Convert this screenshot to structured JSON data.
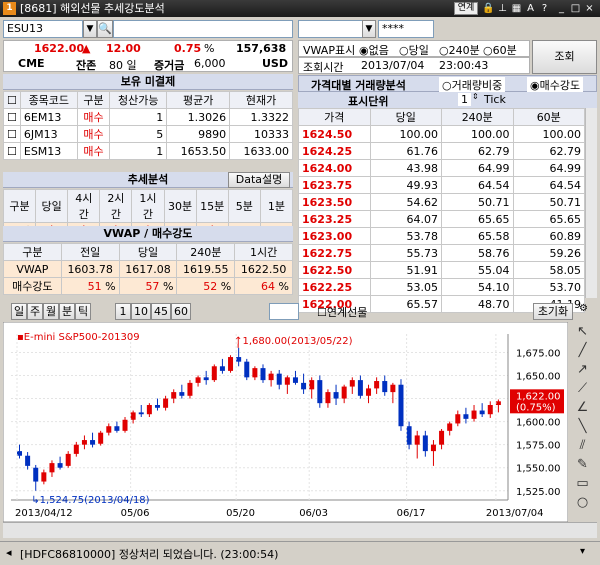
{
  "window": {
    "number": "1",
    "title": "[8681] 해외선물 추세강도분석",
    "buttons": [
      "연계",
      "A",
      "?"
    ],
    "controls": [
      "_",
      "□",
      "×"
    ]
  },
  "search": {
    "symbol": "ESU13",
    "right_value": "****"
  },
  "quote": {
    "price": "1622.00",
    "change_arrow": "▲",
    "change": "12.00",
    "pct": "0.75",
    "pct_unit": "%",
    "volume": "157,638",
    "exchange": "CME",
    "remain_label": "잔존",
    "remain_days": "80 일",
    "deposit_label": "증거금",
    "deposit": "6,000",
    "currency": "USD"
  },
  "vwap_opts": {
    "label": "VWAP표시",
    "options": [
      "없음",
      "당일",
      "240분",
      "60분"
    ],
    "selected": 0
  },
  "query_btn": "조회",
  "query_time": {
    "label": "조회시간",
    "date": "2013/07/04",
    "time": "23:00:43"
  },
  "holdings": {
    "title": "보유 미결제",
    "headers": [
      "종목코드",
      "구분",
      "청산가능",
      "평균가",
      "현재가"
    ],
    "rows": [
      [
        "6EM13",
        "매수",
        "1",
        "1.3026",
        "1.3322"
      ],
      [
        "6JM13",
        "매수",
        "5",
        "9890",
        "10333"
      ],
      [
        "ESM13",
        "매수",
        "1",
        "1653.50",
        "1633.00"
      ]
    ]
  },
  "trend": {
    "title": "추세분석",
    "data_btn": "Data설명",
    "headers": [
      "구분",
      "당일",
      "4시간",
      "2시간",
      "1시간",
      "30분",
      "15분",
      "5분",
      "1분"
    ],
    "row_label": "추세",
    "arrows": [
      "up",
      "up",
      "up",
      "up",
      "dash",
      "up",
      "dash",
      "dash"
    ]
  },
  "vwap": {
    "title": "VWAP / 매수강도",
    "headers": [
      "구분",
      "전일",
      "당일",
      "240분",
      "1시간"
    ],
    "rows": [
      {
        "label": "VWAP",
        "values": [
          "1603.78",
          "1617.08",
          "1619.55",
          "1622.50"
        ]
      },
      {
        "label": "매수강도",
        "values": [
          "51",
          "57",
          "52",
          "64"
        ],
        "unit": "%"
      }
    ]
  },
  "price_vol": {
    "title": "가격대별 거래량분석",
    "opt1": "거래량비중",
    "opt2": "매수강도",
    "selected": 1,
    "unit_label": "표시단위",
    "unit_value": "1",
    "unit_suffix": "Tick",
    "headers": [
      "가격",
      "당일",
      "240분",
      "60분"
    ],
    "rows": [
      [
        "1624.50",
        "100.00",
        "100.00",
        "100.00"
      ],
      [
        "1624.25",
        "61.76",
        "62.79",
        "62.79"
      ],
      [
        "1624.00",
        "43.98",
        "64.99",
        "64.99"
      ],
      [
        "1623.75",
        "49.93",
        "64.54",
        "64.54"
      ],
      [
        "1623.50",
        "54.62",
        "50.71",
        "50.71"
      ],
      [
        "1623.25",
        "64.07",
        "65.65",
        "65.65"
      ],
      [
        "1623.00",
        "53.78",
        "65.58",
        "60.89"
      ],
      [
        "1622.75",
        "55.73",
        "58.76",
        "59.26"
      ],
      [
        "1622.50",
        "51.91",
        "55.04",
        "58.05"
      ],
      [
        "1622.25",
        "53.05",
        "54.10",
        "53.70"
      ],
      [
        "1622.00",
        "65.57",
        "48.70",
        "41.19"
      ]
    ]
  },
  "chart_toolbar": {
    "periods": [
      "일",
      "주",
      "월",
      "분",
      "틱"
    ],
    "intervals": [
      "1",
      "10",
      "45",
      "60"
    ],
    "combo": "",
    "linked": "연계선물",
    "reset": "초기화"
  },
  "chart_data": {
    "type": "candlestick",
    "title": "E-mini S&P500-201309",
    "y_ticks": [
      "1,675.00",
      "1,650.00",
      "1,625.00",
      "1,600.00",
      "1,575.00",
      "1,550.00",
      "1,525.00"
    ],
    "x_ticks": [
      "2013/04/12",
      "05/06",
      "05/20",
      "06/03",
      "06/17",
      "2013/07/04"
    ],
    "high_annotation": "1,680.00(2013/05/22)",
    "low_annotation": "1,524.75(2013/04/18)",
    "last_price": "1,622.00",
    "last_pct": "0.75%",
    "ylim": [
      1515,
      1695
    ],
    "ohlc": [
      [
        1568,
        1575,
        1560,
        1563
      ],
      [
        1563,
        1567,
        1548,
        1552
      ],
      [
        1550,
        1553,
        1525,
        1535
      ],
      [
        1535,
        1548,
        1532,
        1545
      ],
      [
        1545,
        1558,
        1540,
        1555
      ],
      [
        1555,
        1562,
        1548,
        1550
      ],
      [
        1552,
        1568,
        1550,
        1565
      ],
      [
        1565,
        1578,
        1562,
        1575
      ],
      [
        1575,
        1585,
        1570,
        1580
      ],
      [
        1580,
        1588,
        1572,
        1575
      ],
      [
        1576,
        1590,
        1574,
        1588
      ],
      [
        1588,
        1598,
        1585,
        1595
      ],
      [
        1595,
        1600,
        1588,
        1590
      ],
      [
        1590,
        1605,
        1588,
        1602
      ],
      [
        1602,
        1612,
        1598,
        1610
      ],
      [
        1610,
        1618,
        1605,
        1608
      ],
      [
        1608,
        1620,
        1605,
        1618
      ],
      [
        1618,
        1625,
        1612,
        1615
      ],
      [
        1615,
        1628,
        1612,
        1625
      ],
      [
        1625,
        1635,
        1620,
        1632
      ],
      [
        1632,
        1640,
        1625,
        1628
      ],
      [
        1628,
        1645,
        1625,
        1642
      ],
      [
        1642,
        1650,
        1638,
        1648
      ],
      [
        1648,
        1655,
        1640,
        1645
      ],
      [
        1645,
        1662,
        1643,
        1660
      ],
      [
        1660,
        1668,
        1652,
        1655
      ],
      [
        1655,
        1672,
        1653,
        1670
      ],
      [
        1670,
        1680,
        1660,
        1665
      ],
      [
        1665,
        1668,
        1645,
        1648
      ],
      [
        1648,
        1660,
        1645,
        1658
      ],
      [
        1658,
        1662,
        1642,
        1645
      ],
      [
        1645,
        1655,
        1638,
        1652
      ],
      [
        1652,
        1656,
        1635,
        1640
      ],
      [
        1640,
        1650,
        1630,
        1648
      ],
      [
        1648,
        1655,
        1640,
        1642
      ],
      [
        1642,
        1652,
        1630,
        1635
      ],
      [
        1635,
        1648,
        1625,
        1645
      ],
      [
        1645,
        1650,
        1615,
        1620
      ],
      [
        1620,
        1635,
        1615,
        1632
      ],
      [
        1632,
        1640,
        1618,
        1625
      ],
      [
        1625,
        1640,
        1620,
        1638
      ],
      [
        1638,
        1648,
        1630,
        1645
      ],
      [
        1645,
        1650,
        1625,
        1628
      ],
      [
        1628,
        1640,
        1620,
        1636
      ],
      [
        1636,
        1648,
        1630,
        1644
      ],
      [
        1644,
        1650,
        1628,
        1632
      ],
      [
        1632,
        1642,
        1620,
        1640
      ],
      [
        1640,
        1646,
        1590,
        1595
      ],
      [
        1595,
        1600,
        1570,
        1575
      ],
      [
        1575,
        1590,
        1560,
        1585
      ],
      [
        1585,
        1590,
        1562,
        1568
      ],
      [
        1568,
        1580,
        1552,
        1575
      ],
      [
        1575,
        1592,
        1570,
        1590
      ],
      [
        1590,
        1600,
        1585,
        1598
      ],
      [
        1598,
        1612,
        1595,
        1608
      ],
      [
        1608,
        1615,
        1598,
        1603
      ],
      [
        1603,
        1618,
        1600,
        1612
      ],
      [
        1612,
        1620,
        1605,
        1608
      ],
      [
        1608,
        1622,
        1604,
        1618
      ],
      [
        1618,
        1624,
        1610,
        1622
      ]
    ]
  },
  "status": {
    "text": "[HDFC86810000] 정상처리 되었습니다. (23:00:54)"
  }
}
